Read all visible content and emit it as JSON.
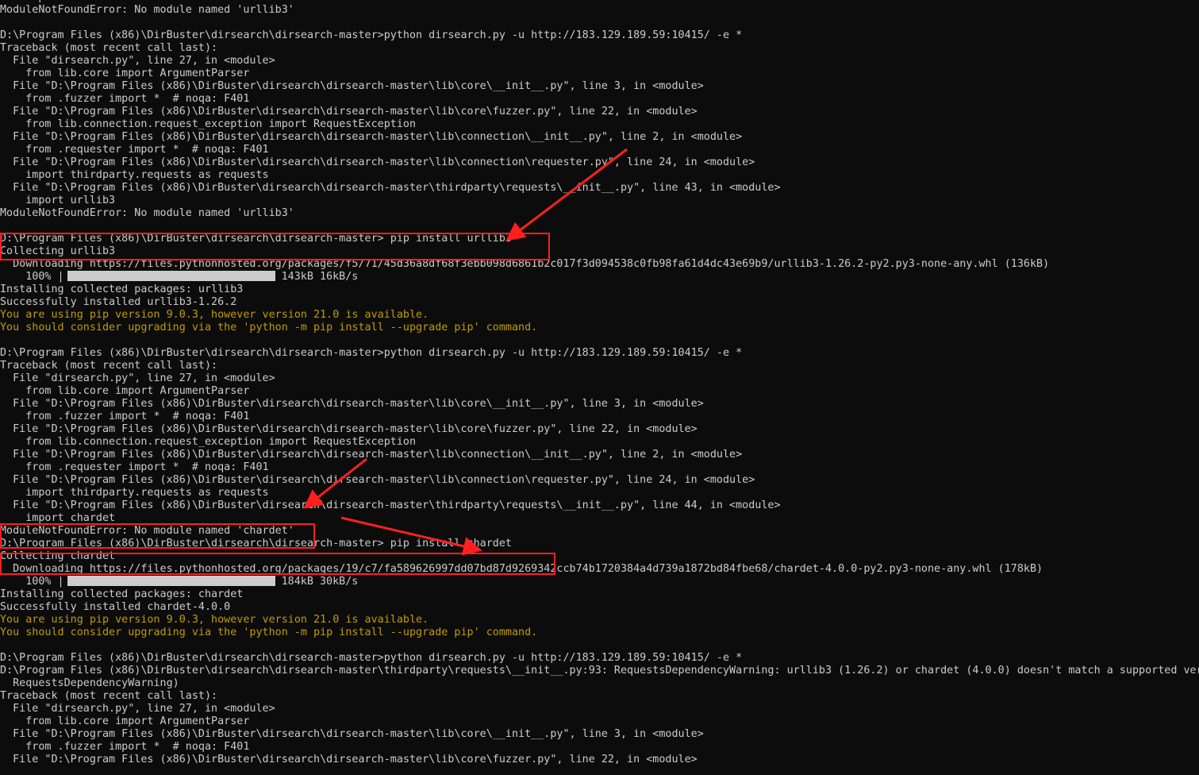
{
  "terminal": {
    "lines": [
      {
        "kind": "text",
        "text": "    import urllib3"
      },
      {
        "kind": "text",
        "text": "ModuleNotFoundError: No module named 'urllib3'"
      },
      {
        "kind": "text",
        "text": ""
      },
      {
        "kind": "text",
        "text": "D:\\Program Files (x86)\\DirBuster\\dirsearch\\dirsearch-master>python dirsearch.py -u http://183.129.189.59:10415/ -e *"
      },
      {
        "kind": "text",
        "text": "Traceback (most recent call last):"
      },
      {
        "kind": "text",
        "text": "  File \"dirsearch.py\", line 27, in <module>"
      },
      {
        "kind": "text",
        "text": "    from lib.core import ArgumentParser"
      },
      {
        "kind": "text",
        "text": "  File \"D:\\Program Files (x86)\\DirBuster\\dirsearch\\dirsearch-master\\lib\\core\\__init__.py\", line 3, in <module>"
      },
      {
        "kind": "text",
        "text": "    from .fuzzer import *  # noqa: F401"
      },
      {
        "kind": "text",
        "text": "  File \"D:\\Program Files (x86)\\DirBuster\\dirsearch\\dirsearch-master\\lib\\core\\fuzzer.py\", line 22, in <module>"
      },
      {
        "kind": "text",
        "text": "    from lib.connection.request_exception import RequestException"
      },
      {
        "kind": "text",
        "text": "  File \"D:\\Program Files (x86)\\DirBuster\\dirsearch\\dirsearch-master\\lib\\connection\\__init__.py\", line 2, in <module>"
      },
      {
        "kind": "text",
        "text": "    from .requester import *  # noqa: F401"
      },
      {
        "kind": "text",
        "text": "  File \"D:\\Program Files (x86)\\DirBuster\\dirsearch\\dirsearch-master\\lib\\connection\\requester.py\", line 24, in <module>"
      },
      {
        "kind": "text",
        "text": "    import thirdparty.requests as requests"
      },
      {
        "kind": "text",
        "text": "  File \"D:\\Program Files (x86)\\DirBuster\\dirsearch\\dirsearch-master\\thirdparty\\requests\\__init__.py\", line 43, in <module>"
      },
      {
        "kind": "text",
        "text": "    import urllib3"
      },
      {
        "kind": "text",
        "text": "ModuleNotFoundError: No module named 'urllib3'"
      },
      {
        "kind": "text",
        "text": ""
      },
      {
        "kind": "text",
        "text": "D:\\Program Files (x86)\\DirBuster\\dirsearch\\dirsearch-master> pip install urllib3"
      },
      {
        "kind": "text",
        "text": "Collecting urllib3"
      },
      {
        "kind": "text",
        "text": "  Downloading https://files.pythonhosted.org/packages/f5/71/45d36a8df68f3ebb098d6861b2c017f3d094538c0fb98fa61d4dc43e69b9/urllib3-1.26.2-py2.py3-none-any.whl (136kB)"
      },
      {
        "kind": "progress",
        "pct": "    100% |",
        "progress": 1.0,
        "stats": "143kB 16kB/s"
      },
      {
        "kind": "text",
        "text": "Installing collected packages: urllib3"
      },
      {
        "kind": "text",
        "text": "Successfully installed urllib3-1.26.2"
      },
      {
        "kind": "warn",
        "text": "You are using pip version 9.0.3, however version 21.0 is available."
      },
      {
        "kind": "warn",
        "text": "You should consider upgrading via the 'python -m pip install --upgrade pip' command."
      },
      {
        "kind": "text",
        "text": ""
      },
      {
        "kind": "text",
        "text": "D:\\Program Files (x86)\\DirBuster\\dirsearch\\dirsearch-master>python dirsearch.py -u http://183.129.189.59:10415/ -e *"
      },
      {
        "kind": "text",
        "text": "Traceback (most recent call last):"
      },
      {
        "kind": "text",
        "text": "  File \"dirsearch.py\", line 27, in <module>"
      },
      {
        "kind": "text",
        "text": "    from lib.core import ArgumentParser"
      },
      {
        "kind": "text",
        "text": "  File \"D:\\Program Files (x86)\\DirBuster\\dirsearch\\dirsearch-master\\lib\\core\\__init__.py\", line 3, in <module>"
      },
      {
        "kind": "text",
        "text": "    from .fuzzer import *  # noqa: F401"
      },
      {
        "kind": "text",
        "text": "  File \"D:\\Program Files (x86)\\DirBuster\\dirsearch\\dirsearch-master\\lib\\core\\fuzzer.py\", line 22, in <module>"
      },
      {
        "kind": "text",
        "text": "    from lib.connection.request_exception import RequestException"
      },
      {
        "kind": "text",
        "text": "  File \"D:\\Program Files (x86)\\DirBuster\\dirsearch\\dirsearch-master\\lib\\connection\\__init__.py\", line 2, in <module>"
      },
      {
        "kind": "text",
        "text": "    from .requester import *  # noqa: F401"
      },
      {
        "kind": "text",
        "text": "  File \"D:\\Program Files (x86)\\DirBuster\\dirsearch\\dirsearch-master\\lib\\connection\\requester.py\", line 24, in <module>"
      },
      {
        "kind": "text",
        "text": "    import thirdparty.requests as requests"
      },
      {
        "kind": "text",
        "text": "  File \"D:\\Program Files (x86)\\DirBuster\\dirsearch\\dirsearch-master\\thirdparty\\requests\\__init__.py\", line 44, in <module>"
      },
      {
        "kind": "text",
        "text": "    import chardet"
      },
      {
        "kind": "text",
        "text": "ModuleNotFoundError: No module named 'chardet'"
      },
      {
        "kind": "text",
        "text": "D:\\Program Files (x86)\\DirBuster\\dirsearch\\dirsearch-master> pip install chardet"
      },
      {
        "kind": "text",
        "text": "Collecting chardet"
      },
      {
        "kind": "text",
        "text": "  Downloading https://files.pythonhosted.org/packages/19/c7/fa589626997dd07bd87d9269342ccb74b1720384a4d739a1872bd84fbe68/chardet-4.0.0-py2.py3-none-any.whl (178kB)"
      },
      {
        "kind": "progress",
        "pct": "    100% |",
        "progress": 1.0,
        "stats": "184kB 30kB/s"
      },
      {
        "kind": "text",
        "text": "Installing collected packages: chardet"
      },
      {
        "kind": "text",
        "text": "Successfully installed chardet-4.0.0"
      },
      {
        "kind": "warn",
        "text": "You are using pip version 9.0.3, however version 21.0 is available."
      },
      {
        "kind": "warn",
        "text": "You should consider upgrading via the 'python -m pip install --upgrade pip' command."
      },
      {
        "kind": "text",
        "text": ""
      },
      {
        "kind": "text",
        "text": "D:\\Program Files (x86)\\DirBuster\\dirsearch\\dirsearch-master>python dirsearch.py -u http://183.129.189.59:10415/ -e *"
      },
      {
        "kind": "text",
        "text": "D:\\Program Files (x86)\\DirBuster\\dirsearch\\dirsearch-master\\thirdparty\\requests\\__init__.py:93: RequestsDependencyWarning: urllib3 (1.26.2) or chardet (4.0.0) doesn't match a supported vers"
      },
      {
        "kind": "text",
        "text": "  RequestsDependencyWarning)"
      },
      {
        "kind": "text",
        "text": "Traceback (most recent call last):"
      },
      {
        "kind": "text",
        "text": "  File \"dirsearch.py\", line 27, in <module>"
      },
      {
        "kind": "text",
        "text": "    from lib.core import ArgumentParser"
      },
      {
        "kind": "text",
        "text": "  File \"D:\\Program Files (x86)\\DirBuster\\dirsearch\\dirsearch-master\\lib\\core\\__init__.py\", line 3, in <module>"
      },
      {
        "kind": "text",
        "text": "    from .fuzzer import *  # noqa: F401"
      },
      {
        "kind": "text",
        "text": "  File \"D:\\Program Files (x86)\\DirBuster\\dirsearch\\dirsearch-master\\lib\\core\\fuzzer.py\", line 22, in <module>"
      }
    ]
  },
  "colors": {
    "background": "#0c0c0c",
    "text": "#cccccc",
    "warning": "#c19c00",
    "annotation": "#ff1f1f"
  }
}
